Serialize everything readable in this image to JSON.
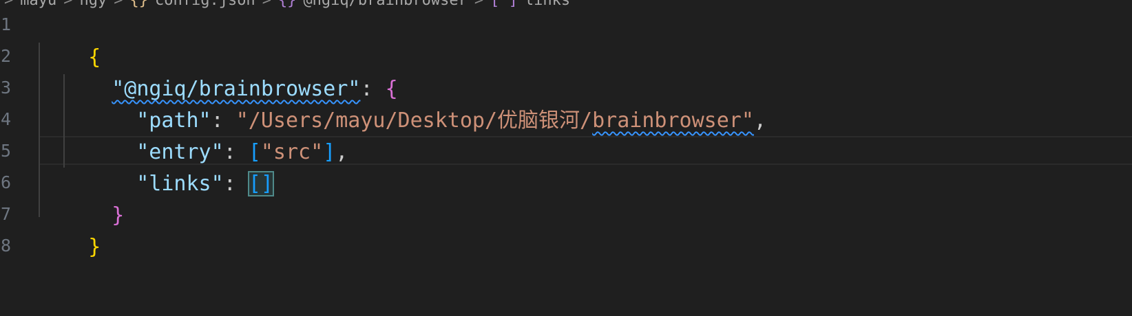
{
  "breadcrumb": {
    "items": [
      "mayu",
      "ngy",
      "config.json",
      "@ngiq/brainbrowser",
      "links"
    ],
    "icons": [
      "none",
      "none",
      "json-braces-icon",
      "object-braces-icon",
      "array-brackets-icon"
    ],
    "separator": ">"
  },
  "editor": {
    "line_numbers": [
      "1",
      "2",
      "3",
      "4",
      "5",
      "6",
      "7",
      "8"
    ],
    "code": {
      "open_root": "{",
      "pkg_key": "\"@ngiq/brainbrowser\"",
      "colon_space": ": ",
      "open_obj": "{",
      "path_key": "\"path\"",
      "path_value_prefix": "\"/Users/mayu/Desktop/优脑银河/",
      "path_value_suffix": "brainbrowser\"",
      "comma": ",",
      "entry_key": "\"entry\"",
      "entry_open": "[",
      "entry_value": "\"src\"",
      "entry_close": "]",
      "links_key": "\"links\"",
      "links_value": "[]",
      "close_obj": "}",
      "close_root": "}"
    }
  },
  "colors": {
    "background": "#1f1f1f",
    "key": "#9cdcfe",
    "string": "#ce9178",
    "brace_level1": "#ffd700",
    "brace_level2": "#da70d6",
    "bracket_level3": "#179fff",
    "squiggle": "#3794ff"
  }
}
